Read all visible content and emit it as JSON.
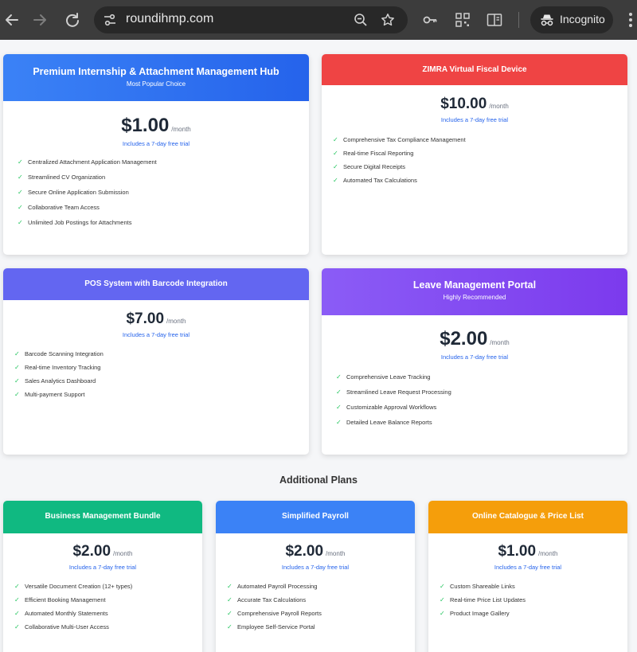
{
  "browser": {
    "url": "roundihmp.com",
    "profile_label": "Incognito",
    "icons": [
      "back-arrow-icon",
      "forward-arrow-icon",
      "reload-icon",
      "tune-icon",
      "zoom-out-icon",
      "star-icon",
      "password-key-icon",
      "qr-code-icon",
      "reading-mode-icon",
      "incognito-icon",
      "menu-dots-icon"
    ]
  },
  "trial_text": "Includes a 7-day free trial",
  "per_month": "/month",
  "check_icon": "✓",
  "colors": {
    "blue_gradient_from": "#3b82f6",
    "blue_gradient_to": "#2563eb",
    "red": "#ef4444",
    "indigo": "#6366f1",
    "purple_from": "#8b5cf6",
    "purple_to": "#7c3aed",
    "green": "#10b981",
    "blue": "#3b82f6",
    "amber": "#f59e0b",
    "check_green": "#22c55e",
    "trial_blue": "#2563eb"
  },
  "plans": [
    {
      "title": "Premium Internship & Attachment Management Hub",
      "subtitle": "Most Popular Choice",
      "price": "$1.00",
      "features": [
        "Centralized Attachment Application Management",
        "Streamlined CV Organization",
        "Secure Online Application Submission",
        "Collaborative Team Access",
        "Unlimited Job Postings for Attachments"
      ]
    },
    {
      "title": "ZIMRA Virtual Fiscal Device",
      "price": "$10.00",
      "features": [
        "Comprehensive Tax Compliance Management",
        "Real-time Fiscal Reporting",
        "Secure Digital Receipts",
        "Automated Tax Calculations"
      ]
    },
    {
      "title": "POS System with Barcode Integration",
      "price": "$7.00",
      "features": [
        "Barcode Scanning Integration",
        "Real-time Inventory Tracking",
        "Sales Analytics Dashboard",
        "Multi-payment Support"
      ]
    },
    {
      "title": "Leave Management Portal",
      "subtitle": "Highly Recommended",
      "price": "$2.00",
      "features": [
        "Comprehensive Leave Tracking",
        "Streamlined Leave Request Processing",
        "Customizable Approval Workflows",
        "Detailed Leave Balance Reports"
      ]
    }
  ],
  "additional_title": "Additional Plans",
  "additional_plans": [
    {
      "title": "Business Management Bundle",
      "price": "$2.00",
      "features": [
        "Versatile Document Creation (12+ types)",
        "Efficient Booking Management",
        "Automated Monthly Statements",
        "Collaborative Multi-User Access"
      ]
    },
    {
      "title": "Simplified Payroll",
      "price": "$2.00",
      "features": [
        "Automated Payroll Processing",
        "Accurate Tax Calculations",
        "Comprehensive Payroll Reports",
        "Employee Self-Service Portal"
      ]
    },
    {
      "title": "Online Catalogue & Price List",
      "price": "$1.00",
      "features": [
        "Custom Shareable Links",
        "Real-time Price List Updates",
        "Product Image Gallery"
      ]
    }
  ]
}
